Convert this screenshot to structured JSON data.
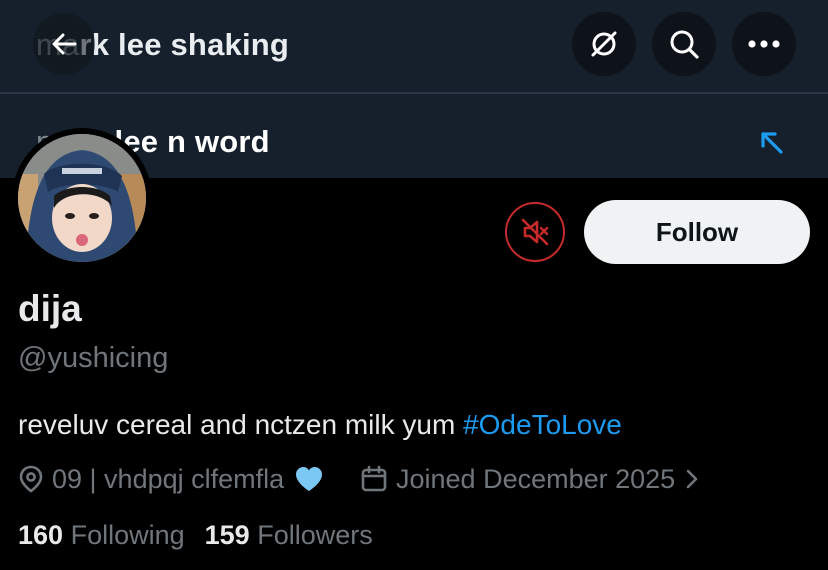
{
  "banner": {
    "search_text_1": "mark lee shaking",
    "search_text_1_faded": "ma",
    "search_text_1_rest": "rk lee shaking",
    "search_text_2_faded": "mark",
    "search_text_2_rest": "lee n word"
  },
  "header_icons": {
    "back": "arrow-left-icon",
    "spin": "no-sign-icon",
    "search": "search-icon",
    "more": "more-icon"
  },
  "profile": {
    "name": "dija",
    "handle": "@yushicing",
    "bio_text": "reveluv cereal and nctzen milk yum ",
    "bio_hashtag": "#OdeToLove",
    "location": "09 | vhdpqj clfemfla",
    "joined": "Joined December 2025",
    "following_count": "160",
    "following_label": "Following",
    "followers_count": "159",
    "followers_label": "Followers"
  },
  "actions": {
    "follow_label": "Follow"
  },
  "colors": {
    "accent": "#1d9bf0",
    "mute_red": "#c62a2a",
    "heart": "#7cc8f5"
  }
}
